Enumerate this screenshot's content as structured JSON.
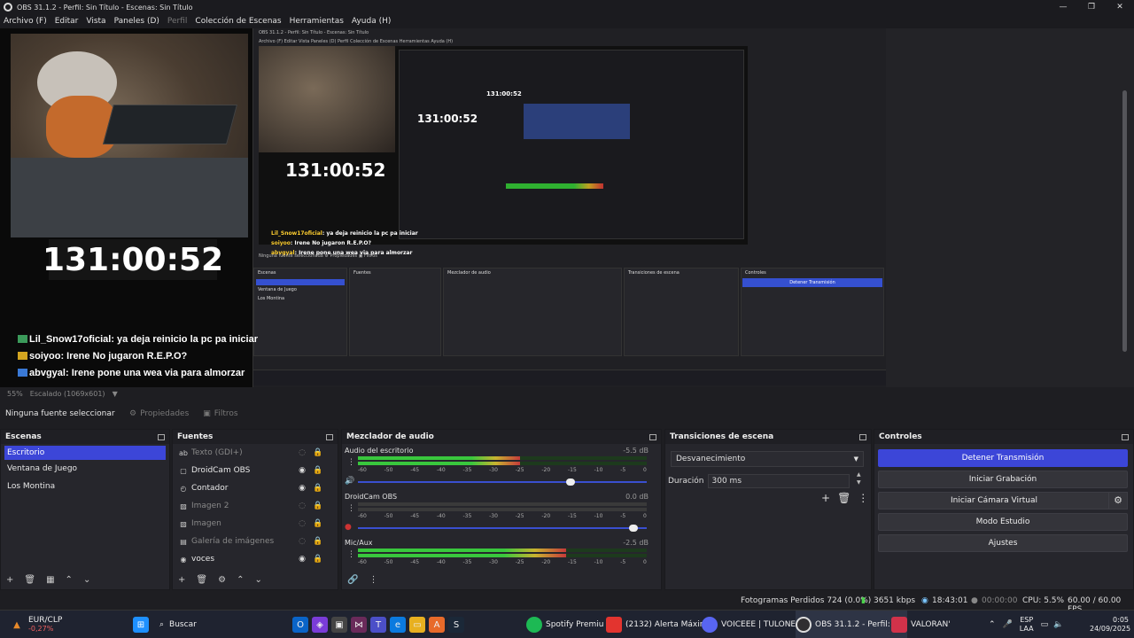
{
  "window": {
    "title": "OBS 31.1.2 - Perfil: Sin Título - Escenas: Sin Título",
    "controls": [
      "—",
      "❐",
      "✕"
    ]
  },
  "menu": [
    "Archivo (F)",
    "Editar",
    "Vista",
    "Paneles (D)",
    "Perfil",
    "Colección de Escenas",
    "Herramientas",
    "Ayuda (H)"
  ],
  "preview": {
    "clock_big": "131:00:52",
    "clock_mid": "131:00:52",
    "clock_small": "131:00:52",
    "clock_tiny": "131:00:52",
    "chat": [
      {
        "user": "Lil_Snow17oficial",
        "text": ": ya deja reinicio la pc pa iniciar",
        "badge": "g"
      },
      {
        "user": "soiyoo",
        "text": ": Irene No jugaron R.E.P.O?",
        "badge": "y"
      },
      {
        "user": "abvgyal",
        "text": ": Irene pone una wea via para almorzar",
        "badge": "b"
      }
    ],
    "nested": {
      "title": "OBS 31.1.2 - Perfil: Sin Título - Escenas: Sin Título",
      "menu": "Archivo (F)  Editar  Vista  Paneles (D)  Perfil  Colección de Escenas  Herramientas  Ayuda (H)",
      "src_bar": "Ninguna fuente seleccionada     ⚙ Propiedades     ▣ Filtros",
      "dock_titles": [
        "Escenas",
        "Fuentes",
        "Mezclador de audio",
        "Transiciones de escena",
        "Controles"
      ],
      "scenes": [
        "Escritorio",
        "Ventana de Juego",
        "Los Montina"
      ],
      "stream_btn": "Detener Transmisión"
    },
    "zoom": "55%",
    "scale": "Escalado (1069x601)"
  },
  "context": {
    "no_source": "Ninguna fuente seleccionar",
    "properties": "Propiedades",
    "filters": "Filtros"
  },
  "scenes": {
    "title": "Escenas",
    "items": [
      "Escritorio",
      "Ventana de Juego",
      "Los Montina"
    ],
    "selected": 0
  },
  "sources": {
    "title": "Fuentes",
    "items": [
      {
        "name": "Texto (GDI+)",
        "icon": "ab",
        "visible": false
      },
      {
        "name": "DroidCam OBS",
        "icon": "▢",
        "visible": true
      },
      {
        "name": "Contador",
        "icon": "◴",
        "visible": true
      },
      {
        "name": "Imagen 2",
        "icon": "▨",
        "visible": false
      },
      {
        "name": "Imagen",
        "icon": "▨",
        "visible": false
      },
      {
        "name": "Galería de imágenes",
        "icon": "▤",
        "visible": false
      },
      {
        "name": "voces",
        "icon": "◉",
        "visible": true
      }
    ]
  },
  "mixer": {
    "title": "Mezclador de audio",
    "ticks": [
      "-60",
      "-50",
      "-45",
      "-40",
      "-35",
      "-30",
      "-25",
      "-20",
      "-15",
      "-10",
      "-5",
      "0"
    ],
    "channels": [
      {
        "name": "Audio del escritorio",
        "db": "-5.5 dB",
        "level": 0.56,
        "volume": 0.75,
        "muted": false
      },
      {
        "name": "DroidCam OBS",
        "db": "0.0 dB",
        "level": 0.0,
        "volume": 0.97,
        "muted": true
      },
      {
        "name": "Mic/Aux",
        "db": "-2.5 dB",
        "level": 0.72,
        "volume": 0.85,
        "muted": false
      }
    ]
  },
  "transitions": {
    "title": "Transiciones de escena",
    "selected": "Desvanecimiento",
    "duration_label": "Duración",
    "duration_value": "300 ms"
  },
  "controls": {
    "title": "Controles",
    "buttons": [
      "Detener Transmisión",
      "Iniciar Grabación",
      "Iniciar Cámara Virtual",
      "Modo Estudio",
      "Ajustes"
    ]
  },
  "status": {
    "dropped": "Fotogramas Perdidos 724 (0.0%)",
    "bitrate": "3651 kbps",
    "stream_time": "18:43:01",
    "rec_time": "00:00:00",
    "cpu": "CPU: 5.5%",
    "fps": "60.00 / 60.00 FPS"
  },
  "taskbar": {
    "stock_name": "EUR/CLP",
    "stock_change": "-0,27%",
    "search": "Buscar",
    "apps": [
      {
        "label": "Spotify Premiu",
        "color": "#1db954"
      },
      {
        "label": "(2132) Alerta Máxim",
        "color": "#e3342f"
      },
      {
        "label": "VOICEEE | TULONES '",
        "color": "#5865f2"
      },
      {
        "label": "OBS 31.1.2 - Perfil: Sir",
        "color": "#302e31"
      },
      {
        "label": "VALORAN'",
        "color": "#d1324a"
      }
    ],
    "lang1": "ESP",
    "lang2": "LAA",
    "time": "0:05",
    "date": "24/09/2025"
  }
}
